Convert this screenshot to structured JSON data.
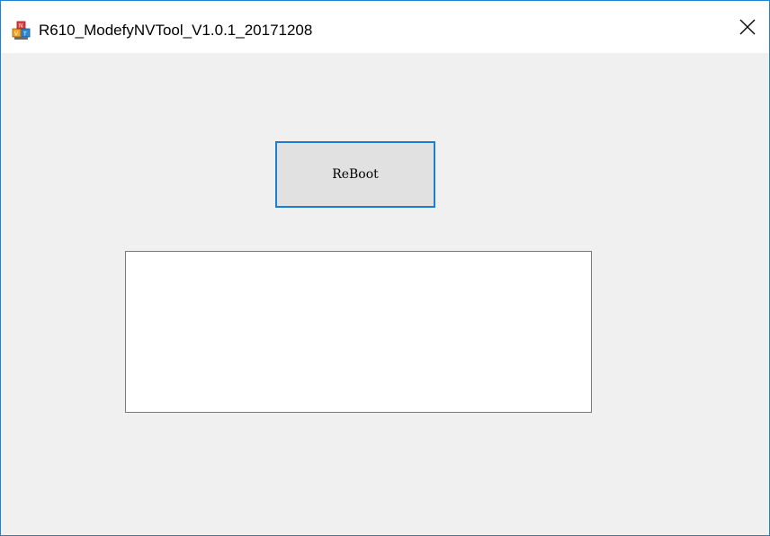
{
  "window": {
    "title": "R610_ModefyNVTool_V1.0.1_20171208",
    "app_icon": "app-icon",
    "close_icon": "close-icon",
    "border_color": "#1883d7"
  },
  "main": {
    "reboot_label": "ReBoot",
    "output_text": ""
  },
  "colors": {
    "accent": "#1a7fd4",
    "client_bg": "#f0f0f0",
    "button_bg": "#e1e1e1"
  }
}
